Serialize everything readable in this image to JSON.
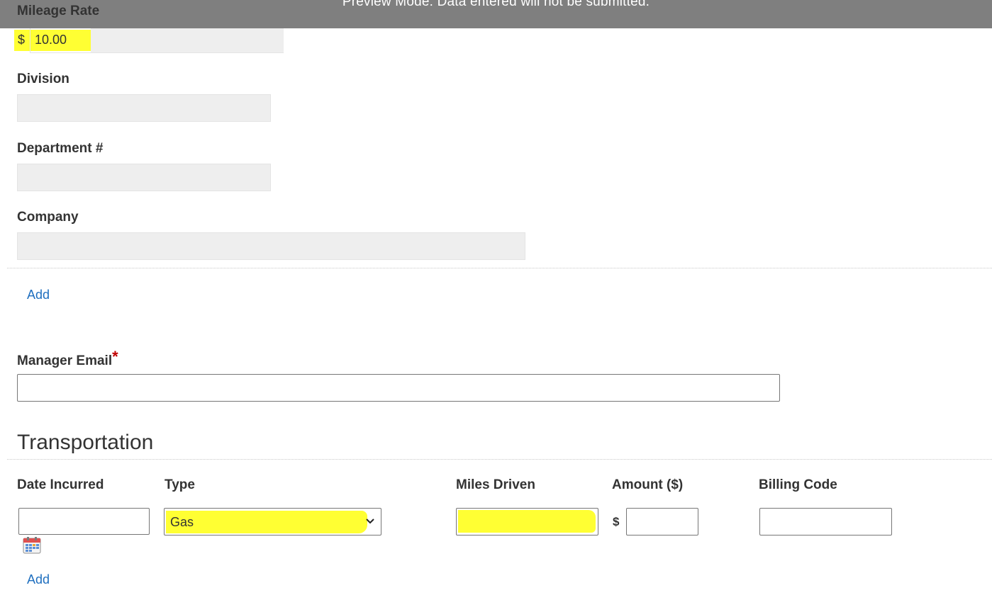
{
  "banner": {
    "text": "Preview Mode: Data entered will not be submitted."
  },
  "mileage_rate": {
    "label": "Mileage Rate",
    "currency": "$",
    "value": "10.00"
  },
  "division": {
    "label": "Division",
    "value": ""
  },
  "department": {
    "label": "Department #",
    "value": ""
  },
  "company": {
    "label": "Company",
    "value": ""
  },
  "add_link_1": {
    "label": "Add"
  },
  "manager_email": {
    "label": "Manager Email",
    "required_mark": "*",
    "value": ""
  },
  "transportation": {
    "title": "Transportation",
    "columns": {
      "date": "Date Incurred",
      "type": "Type",
      "miles": "Miles Driven",
      "amount": "Amount ($)",
      "billing": "Billing Code"
    },
    "row": {
      "date": "",
      "type": "Gas",
      "miles": "",
      "amount_currency": "$",
      "amount": "",
      "billing": ""
    },
    "add_label": "Add"
  },
  "colors": {
    "highlight": "#ffff33",
    "banner": "#7f7f7f",
    "link": "#1f6fbf",
    "required": "#c00000"
  },
  "icons": {
    "calendar": "calendar-icon",
    "dropdown": "chevron-down-icon"
  }
}
